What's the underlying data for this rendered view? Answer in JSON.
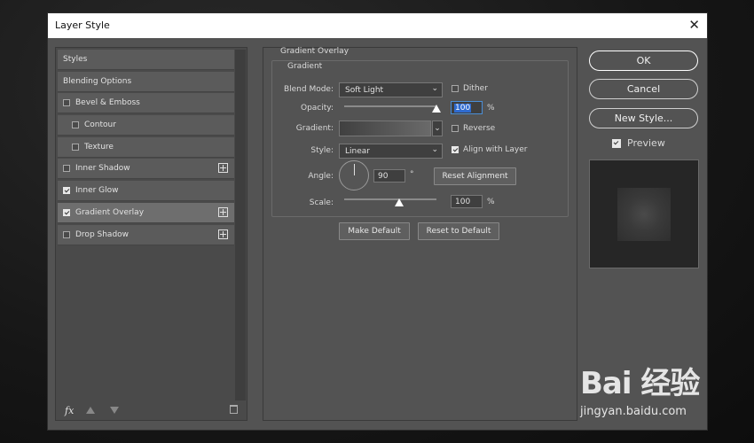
{
  "window": {
    "title": "Layer Style",
    "close_glyph": "✕"
  },
  "left_panel": {
    "items": [
      {
        "label": "Styles",
        "checkbox": false,
        "checked": false,
        "plus": false,
        "indent": 0,
        "selected": false
      },
      {
        "label": "Blending Options",
        "checkbox": false,
        "checked": false,
        "plus": false,
        "indent": 0,
        "selected": false
      },
      {
        "label": "Bevel & Emboss",
        "checkbox": true,
        "checked": false,
        "plus": false,
        "indent": 0,
        "selected": false
      },
      {
        "label": "Contour",
        "checkbox": true,
        "checked": false,
        "plus": false,
        "indent": 1,
        "selected": false
      },
      {
        "label": "Texture",
        "checkbox": true,
        "checked": false,
        "plus": false,
        "indent": 1,
        "selected": false
      },
      {
        "label": "Inner Shadow",
        "checkbox": true,
        "checked": false,
        "plus": true,
        "indent": 0,
        "selected": false
      },
      {
        "label": "Inner Glow",
        "checkbox": true,
        "checked": true,
        "plus": false,
        "indent": 0,
        "selected": false
      },
      {
        "label": "Gradient Overlay",
        "checkbox": true,
        "checked": true,
        "plus": true,
        "indent": 0,
        "selected": true
      },
      {
        "label": "Drop Shadow",
        "checkbox": true,
        "checked": false,
        "plus": true,
        "indent": 0,
        "selected": false
      }
    ],
    "fx_label": "fx"
  },
  "gradient_overlay": {
    "section_title": "Gradient Overlay",
    "group_title": "Gradient",
    "blend_mode": {
      "label": "Blend Mode:",
      "value": "Soft Light"
    },
    "dither": {
      "label": "Dither",
      "checked": false
    },
    "opacity": {
      "label": "Opacity:",
      "value": "100",
      "unit": "%",
      "fraction": 1.0
    },
    "gradient": {
      "label": "Gradient:"
    },
    "reverse": {
      "label": "Reverse",
      "checked": false
    },
    "style": {
      "label": "Style:",
      "value": "Linear"
    },
    "align_with_layer": {
      "label": "Align with Layer",
      "checked": true
    },
    "angle": {
      "label": "Angle:",
      "value": "90",
      "unit": "°"
    },
    "reset_alignment": "Reset Alignment",
    "scale": {
      "label": "Scale:",
      "value": "100",
      "unit": "%",
      "fraction": 0.6
    },
    "make_default": "Make Default",
    "reset_to_default": "Reset to Default"
  },
  "right_panel": {
    "ok": "OK",
    "cancel": "Cancel",
    "new_style": "New Style...",
    "preview": {
      "label": "Preview",
      "checked": true
    }
  },
  "watermark": {
    "big": "Bai 经验",
    "small": "jingyan.baidu.com"
  }
}
